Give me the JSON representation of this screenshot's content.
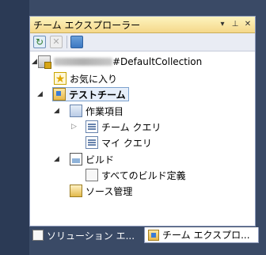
{
  "panel": {
    "title": "チーム エクスプローラー",
    "title_buttons": [
      "▾",
      "ₚ",
      "✕"
    ]
  },
  "toolbar": {
    "buttons": [
      "refresh-icon",
      "stop-icon",
      "add-server-icon"
    ]
  },
  "tree": {
    "server_suffix": "#DefaultCollection",
    "favorites": "お気に入り",
    "team": "テストチーム",
    "work_items": "作業項目",
    "team_query": "チーム クエリ",
    "my_query": "マイ クエリ",
    "builds": "ビルド",
    "all_build_defs": "すべてのビルド定義",
    "source_control": "ソース管理"
  },
  "tabs": [
    {
      "label": "ソリューション エ..."
    },
    {
      "label": "チーム エクスプロ..."
    }
  ]
}
